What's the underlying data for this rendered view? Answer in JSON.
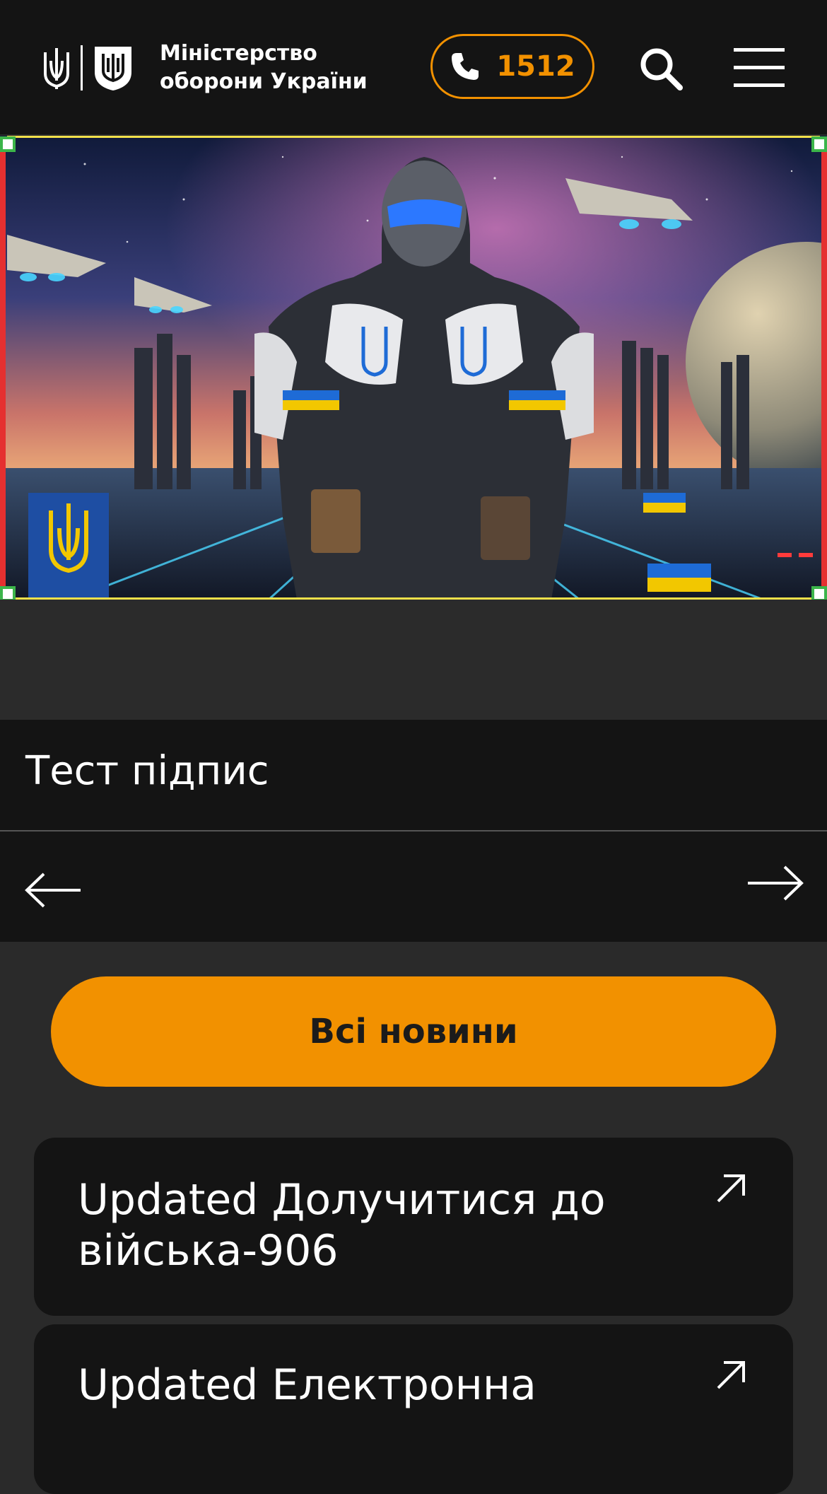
{
  "header": {
    "ministry_line1": "Міністерство",
    "ministry_line2": "оборони України",
    "phone_number": "1512",
    "accent_color": "#f29100",
    "icons": [
      "trident-icon",
      "shield-icon",
      "phone-icon",
      "search-icon",
      "hamburger-menu-icon"
    ]
  },
  "hero": {
    "image_description_icon": "hero-image"
  },
  "slider": {
    "caption": "Тест підпис",
    "prev_icon": "arrow-left-icon",
    "next_icon": "arrow-right-icon"
  },
  "all_news_button": "Всі новини",
  "news": [
    {
      "title": "Updated Долучитися до війська-906",
      "icon": "external-arrow-icon"
    },
    {
      "title": "Updated Електронна",
      "icon": "external-arrow-icon"
    }
  ]
}
